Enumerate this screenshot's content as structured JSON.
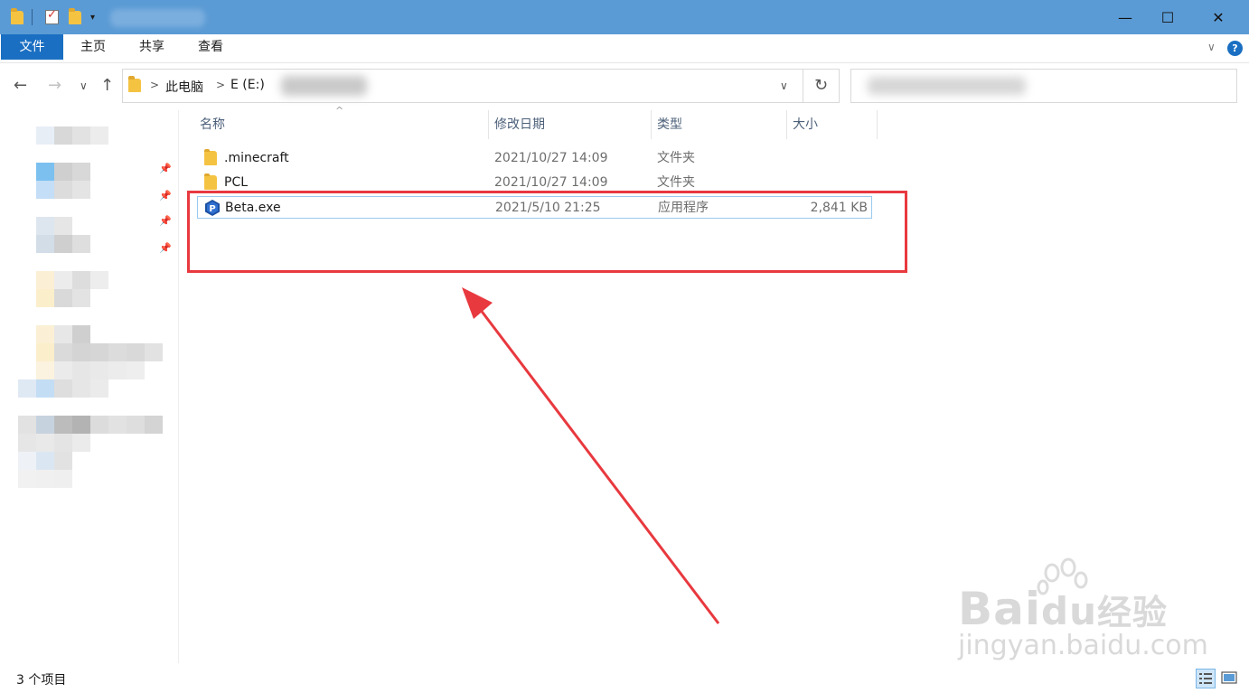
{
  "titlebar": {
    "qat_dropdown_glyph": "▾",
    "minimize_glyph": "—",
    "maximize_glyph": "☐",
    "close_glyph": "✕"
  },
  "ribbon": {
    "tabs": [
      {
        "label": "文件"
      },
      {
        "label": "主页"
      },
      {
        "label": "共享"
      },
      {
        "label": "查看"
      }
    ],
    "expand_glyph": "∨",
    "help_glyph": "?"
  },
  "nav": {
    "back_glyph": "←",
    "forward_glyph": "→",
    "recent_glyph": "∨",
    "up_glyph": "↑",
    "breadcrumb": [
      "此电脑",
      "E (E:)"
    ],
    "crumb_separator": ">",
    "address_dropdown_glyph": "∨",
    "refresh_glyph": "↻"
  },
  "columns": {
    "name": "名称",
    "modified": "修改日期",
    "type": "类型",
    "size": "大小",
    "sort_glyph": "^"
  },
  "files": [
    {
      "name": ".minecraft",
      "modified": "2021/10/27 14:09",
      "type": "文件夹",
      "size": "",
      "icon": "folder-icon"
    },
    {
      "name": "PCL",
      "modified": "2021/10/27 14:09",
      "type": "文件夹",
      "size": "",
      "icon": "folder-icon"
    },
    {
      "name": "Beta.exe",
      "modified": "2021/5/10 21:25",
      "type": "应用程序",
      "size": "2,841 KB",
      "icon": "app-icon"
    }
  ],
  "sidebar": {
    "pin_glyph": "📌"
  },
  "status": {
    "item_count": "3 个项目"
  },
  "watermark": {
    "main": "Bai",
    "mid": "du",
    "cn": "经验",
    "sub": "jingyan.baidu.com"
  },
  "colors": {
    "titlebar": "#5b9bd5",
    "file_tab": "#1a6fc2",
    "highlight": "#e8393f",
    "folder": "#f5c342",
    "selection_border": "#99c9ef"
  }
}
